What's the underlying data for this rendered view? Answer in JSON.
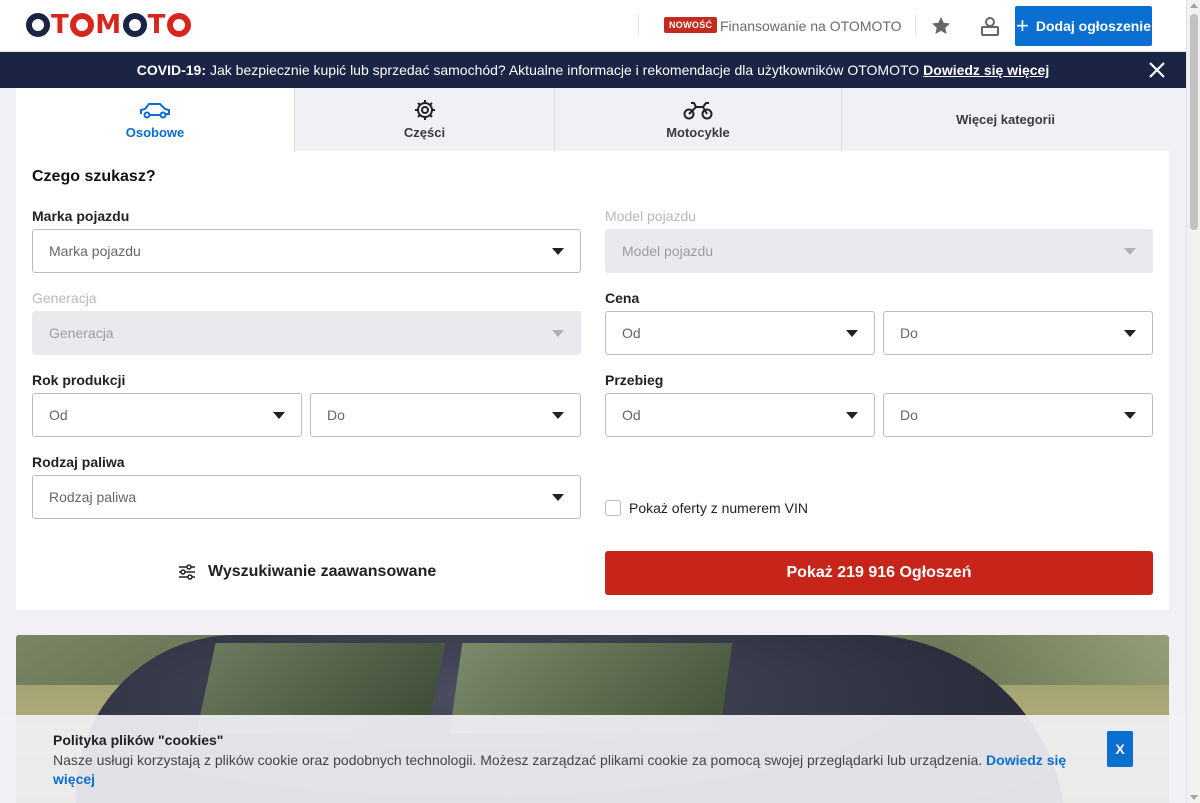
{
  "header": {
    "logo_text": "OTOMOTO",
    "new_badge": "NOWOŚĆ",
    "finance_link": "Finansowanie na OTOMOTO",
    "add_button": "Dodaj ogłoszenie",
    "icons": [
      "star-icon",
      "user-icon",
      "plus-icon"
    ]
  },
  "covid_bar": {
    "prefix": "COVID-19:",
    "text": "Jak bezpiecznie kupić lub sprzedać samochód? Aktualne informacje i rekomendacje dla użytkowników OTOMOTO",
    "link": "Dowiedz się więcej"
  },
  "tabs": [
    {
      "label": "Osobowe",
      "icon": "car-icon",
      "active": true
    },
    {
      "label": "Części",
      "icon": "gear-icon",
      "active": false
    },
    {
      "label": "Motocykle",
      "icon": "motorcycle-icon",
      "active": false
    },
    {
      "label": "Więcej kategorii",
      "icon": "",
      "active": false
    }
  ],
  "search": {
    "title": "Czego szukasz?",
    "brand": {
      "label": "Marka pojazdu",
      "placeholder": "Marka pojazdu"
    },
    "model": {
      "label": "Model pojazdu",
      "placeholder": "Model pojazdu",
      "disabled": true
    },
    "generation": {
      "label": "Generacja",
      "placeholder": "Generacja",
      "disabled": true
    },
    "price": {
      "label": "Cena",
      "from": "Od",
      "to": "Do"
    },
    "year": {
      "label": "Rok produkcji",
      "from": "Od",
      "to": "Do"
    },
    "mileage": {
      "label": "Przebieg",
      "from": "Od",
      "to": "Do"
    },
    "fuel": {
      "label": "Rodzaj paliwa",
      "placeholder": "Rodzaj paliwa"
    },
    "vin_checkbox": "Pokaż oferty z numerem VIN",
    "advanced": "Wyszukiwanie zaawansowane",
    "show_button": "Pokaż 219 916 Ogłoszeń"
  },
  "cookie": {
    "title": "Polityka plików \"cookies\"",
    "text": "Nasze usługi korzystają z plików cookie oraz podobnych technologii. Możesz zarządzać plikami cookie za pomocą swojej przeglądarki lub urządzenia.",
    "link": "Dowiedz się więcej",
    "close": "X"
  },
  "colors": {
    "brand_red": "#d7261e",
    "navy": "#1b2445",
    "accent_blue": "#0a6fd0",
    "cta_red": "#c8251a"
  }
}
